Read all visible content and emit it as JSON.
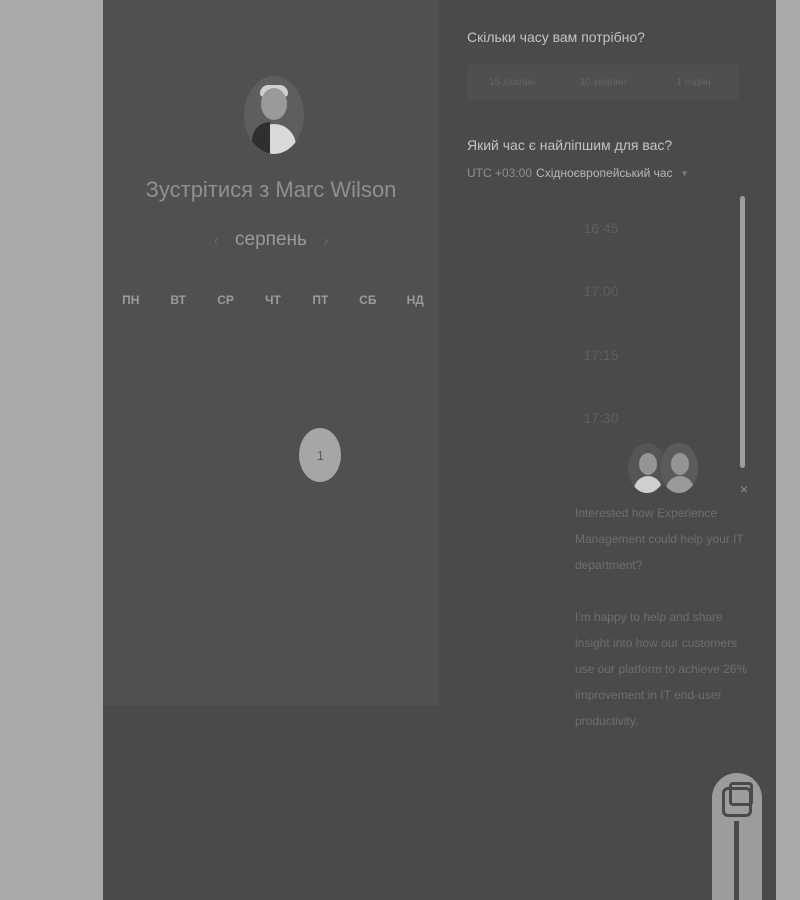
{
  "calendar": {
    "meeting_title": "Зустрітися з Marc Wilson",
    "month": "серпень",
    "prev_icon": "chevron-left-icon",
    "next_icon": "chevron-right-icon",
    "weekdays": [
      "ПН",
      "ВТ",
      "СР",
      "ЧТ",
      "ПТ",
      "СБ",
      "НД"
    ],
    "weeks": [
      [
        "",
        "",
        "",
        "",
        "",
        "",
        ""
      ],
      [
        "",
        "",
        "",
        "",
        "",
        "",
        ""
      ],
      [
        "",
        "",
        "",
        "",
        "1",
        "",
        ""
      ],
      [
        "",
        "",
        "",
        "",
        "",
        "",
        ""
      ],
      [
        "",
        "",
        "",
        "",
        "",
        "",
        ""
      ]
    ],
    "selected_day": "1"
  },
  "duration": {
    "question": "Скільки часу вам потрібно?",
    "options": [
      "15 хвилин",
      "30 хвилин",
      "1 годин"
    ]
  },
  "schedule": {
    "question": "Який час є найліпшим для вас?",
    "tz_offset": "UTC +03:00",
    "tz_name": "Східноєвропейський час",
    "tz_icon": "caret-down-icon",
    "times": [
      "16:45",
      "17:00",
      "17:15",
      "17:30"
    ]
  },
  "chat": {
    "message_1": "Interested how Experience Management could help your IT department?",
    "message_2": "I'm happy to help and share insight into how our customers use our platform to achieve 26% improvement in IT end-user productivity.",
    "close_icon": "close-icon",
    "close_glyph": "×"
  },
  "colors": {
    "overlay_bg": "#a9a9a9",
    "panel_bg": "#4a4a4a",
    "selected_day_bg": "#a6a6a6"
  }
}
